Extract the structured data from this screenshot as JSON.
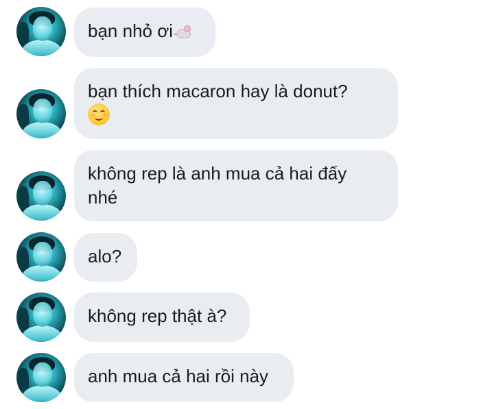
{
  "messages": [
    {
      "text": "bạn nhỏ ơi",
      "emoji": "mouse-emoji"
    },
    {
      "text": "bạn thích macaron hay là donut?\n",
      "emoji": "smiling-face-emoji"
    },
    {
      "text": "không rep là anh mua cả hai đấy\nnhé",
      "emoji": ""
    },
    {
      "text": "alo?",
      "emoji": ""
    },
    {
      "text": "không rep thật à?",
      "emoji": ""
    },
    {
      "text": "anh mua cả hai rồi này",
      "emoji": ""
    }
  ],
  "colors": {
    "bubble": "#e9ecf1",
    "text": "#1b1b1b",
    "background": "#ffffff"
  }
}
